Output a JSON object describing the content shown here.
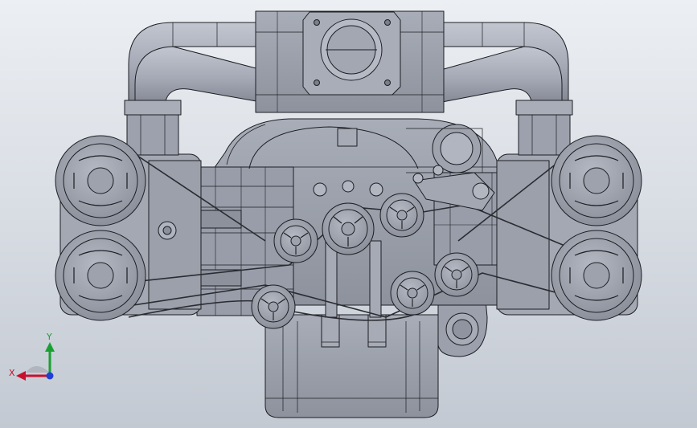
{
  "view": {
    "triad": {
      "x_label": "X",
      "y_label": "Y",
      "x_color": "#c8102e",
      "y_color": "#1aa032",
      "z_color": "#1f3fd6"
    }
  },
  "colors": {
    "background_top": "#eceff3",
    "background_bottom": "#c3c9d2",
    "part_fill": "#9ea3b0",
    "part_light": "#b7bbc6",
    "part_dark": "#70757f",
    "edge": "#1c1e22"
  }
}
